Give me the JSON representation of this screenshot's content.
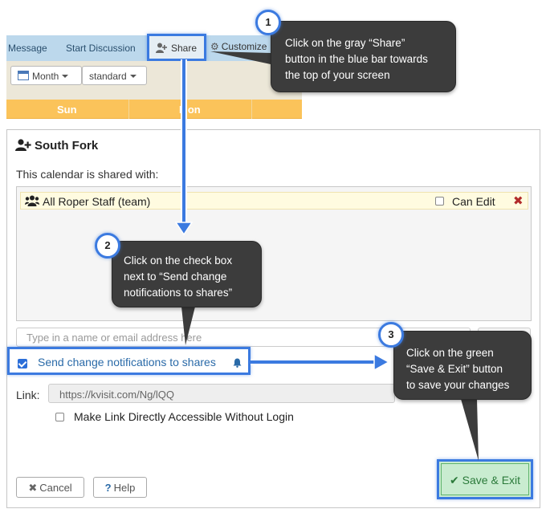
{
  "app_bar": {
    "nav_items": [
      "Message",
      "Start Discussion"
    ],
    "share_label": "Share",
    "customize_label": "Customize"
  },
  "calendar_toolbar": {
    "view_select": "Month",
    "style_select": "standard"
  },
  "calendar_header": {
    "days": [
      "Sun",
      "Mon"
    ]
  },
  "dialog": {
    "title": "South Fork",
    "shared_with_label": "This calendar is shared with:",
    "shares": [
      {
        "name": "All Roper Staff (team)",
        "can_edit_label": "Can Edit",
        "can_edit_checked": false
      }
    ],
    "name_input_placeholder": "Type in a name or email address here",
    "notify_label": "Send change notifications to shares",
    "notify_checked": true,
    "link_label": "Link:",
    "link_value": "https://kvisit.com/Ng/lQQ",
    "direct_access_label": "Make Link Directly Accessible Without Login",
    "direct_access_checked": false,
    "cancel_label": "Cancel",
    "help_label": "Help",
    "save_label": "Save & Exit"
  },
  "callouts": [
    {
      "number": "1",
      "lines": [
        "Click on the gray “Share”",
        "button in the blue bar towards",
        "the top of your screen"
      ]
    },
    {
      "number": "2",
      "lines": [
        "Click on the check box",
        "next to “Send change",
        "notifications to shares”"
      ]
    },
    {
      "number": "3",
      "lines": [
        "Click on the green",
        "“Save & Exit” button",
        "to save your changes"
      ]
    }
  ],
  "colors": {
    "highlight_blue": "#3b7ae0",
    "app_bar": "#bcd8ec",
    "day_header": "#fbc35a",
    "save_green": "#c9ecd0",
    "callout_bg": "#3c3c3c"
  }
}
